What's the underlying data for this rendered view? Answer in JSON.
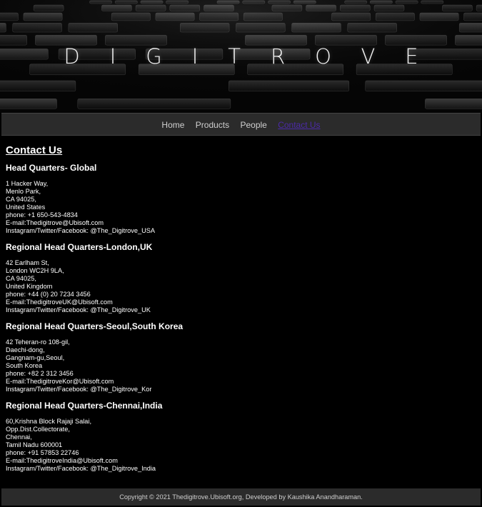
{
  "banner": {
    "brand": "DIGITROVE"
  },
  "nav": {
    "items": [
      {
        "label": "Home"
      },
      {
        "label": "Products"
      },
      {
        "label": "People"
      },
      {
        "label": "Contact Us"
      }
    ]
  },
  "main": {
    "title": "Contact Us",
    "offices": [
      {
        "heading": "Head Quarters- Global",
        "lines": [
          "1 Hacker Way,",
          "Menlo Park,",
          "CA 94025,",
          "United States",
          "phone: +1 650-543-4834",
          "E-mail:Thedigitrove@Ubisoft.com",
          "Instagram/Twitter/Facebook: @The_Digitrove_USA"
        ]
      },
      {
        "heading": "Regional Head Quarters-London,UK",
        "lines": [
          "42 Earlham St,",
          "London WC2H 9LA,",
          "CA 94025,",
          "United Kingdom",
          "phone: +44 (0) 20 7234 3456",
          "E-mail:ThedigitroveUK@Ubisoft.com",
          "Instagram/Twitter/Facebook: @The_Digitrove_UK"
        ]
      },
      {
        "heading": "Regional Head Quarters-Seoul,South Korea",
        "lines": [
          "42 Teheran-ro 108-gil,",
          "Daechi-dong,",
          "Gangnam-gu,Seoul,",
          "South Korea",
          "phone: +82 2 312 3456",
          "E-mail:ThedigitroveKor@Ubisoft.com",
          "Instagram/Twitter/Facebook: @The_Digitrove_Kor"
        ]
      },
      {
        "heading": "Regional Head Quarters-Chennai,India",
        "lines": [
          "60,Krishna Block Rajaji Salai,",
          "Opp.Dist.Collectorate,",
          "Chennai,",
          "Tamil Nadu 600001",
          "phone: +91 57853 22746",
          "E-mail:ThedigitroveIndia@Ubisoft.com",
          "Instagram/Twitter/Facebook: @The_Digitrove_India"
        ]
      }
    ]
  },
  "footer": {
    "text": "Copyright © 2021 Thedigitrove.Ubisoft.org, Developed by Kaushika Anandharaman."
  },
  "colors": {
    "background": "#000000",
    "nav_bg": "#2b2b2b",
    "active_link": "#4b2aa8",
    "nav_text": "#cfcfcf"
  }
}
